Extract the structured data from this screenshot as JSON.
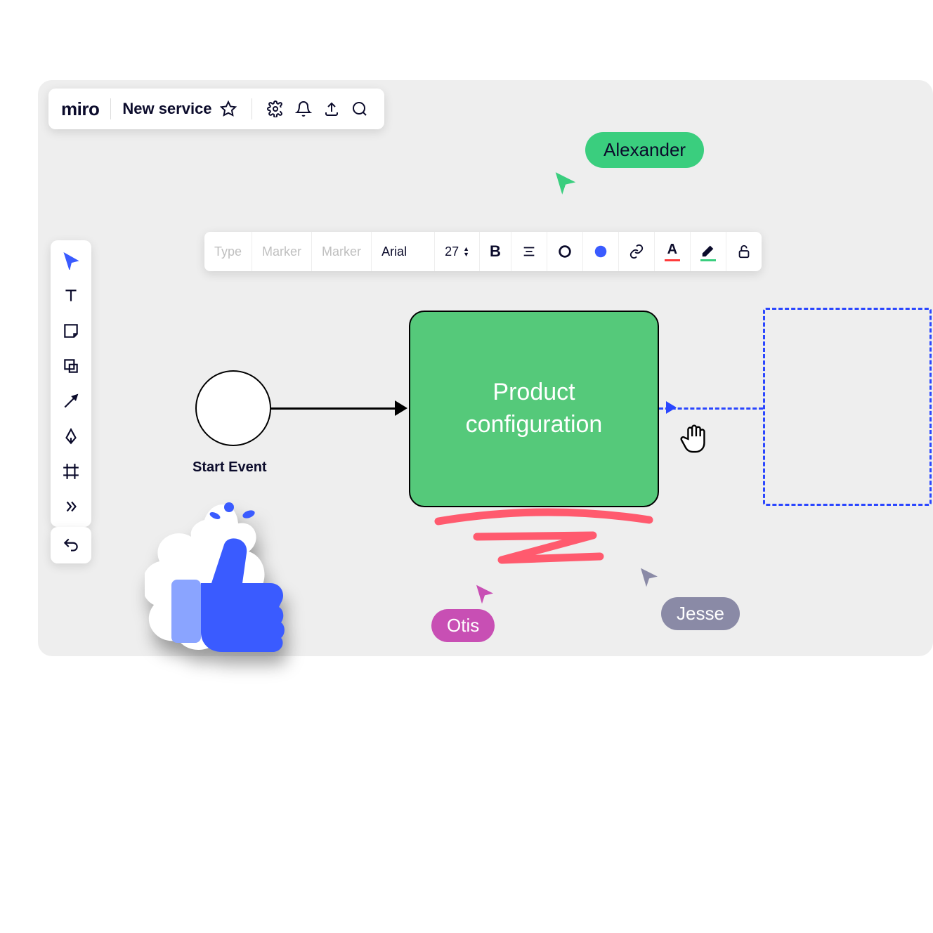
{
  "app": {
    "logo": "miro",
    "board_name": "New service"
  },
  "format_bar": {
    "type": "Type",
    "marker1": "Marker",
    "marker2": "Marker",
    "font": "Arial",
    "font_size": "27"
  },
  "diagram": {
    "start_label": "Start Event",
    "node_label": "Product\nconfiguration"
  },
  "users": {
    "alexander": "Alexander",
    "otis": "Otis",
    "jesse": "Jesse"
  },
  "colors": {
    "accent": "#3a5bff",
    "green": "#55c97a",
    "pink": "#ff5a6e",
    "purple": "#c84fb4",
    "grey": "#8a8aa6"
  }
}
